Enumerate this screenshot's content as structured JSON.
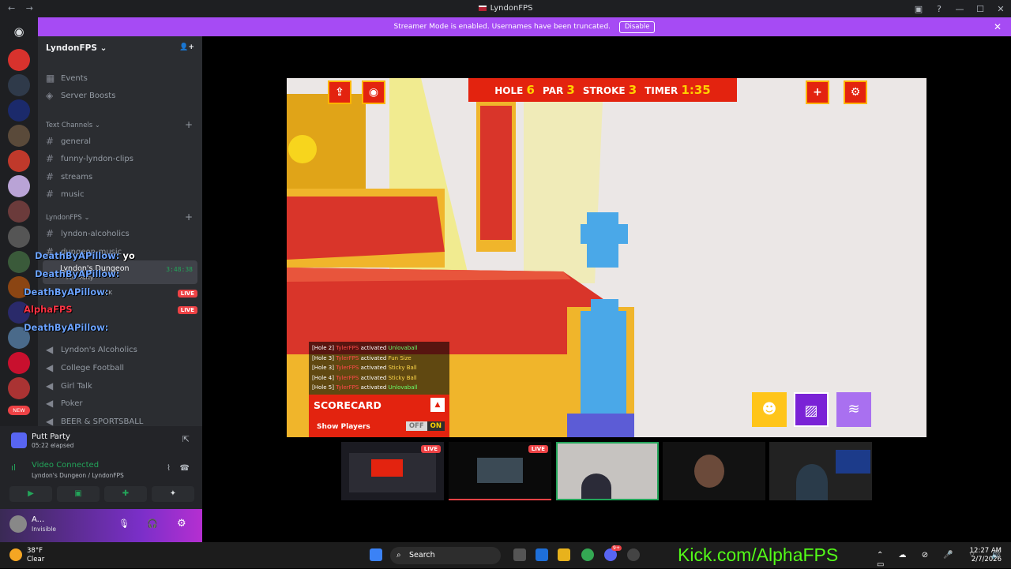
{
  "window": {
    "title": "LyndonFPS",
    "nav_back": "←",
    "nav_fwd": "→",
    "btn_inbox": "▣",
    "btn_help": "?",
    "btn_min": "—",
    "btn_max": "☐",
    "btn_close": "✕"
  },
  "banner": {
    "text": "Streamer Mode is enabled. Usernames have been truncated.",
    "disable_label": "Disable",
    "close_label": "✕"
  },
  "guild": {
    "name": "LyndonFPS",
    "chevron": "⌄",
    "invite_icon": "👤+"
  },
  "channels": {
    "top_items": [
      {
        "label": "Events"
      },
      {
        "label": "Server Boosts"
      }
    ],
    "cat_text": "Text Channels",
    "cat_lyndon": "LyndonFPS",
    "cat_plus": "+",
    "cat_chevron": "⌄",
    "text": [
      {
        "label": "general"
      },
      {
        "label": "funny-lyndon-clips"
      },
      {
        "label": "streams"
      },
      {
        "label": "music"
      }
    ],
    "lyndon": [
      {
        "label": "lyndon-alcoholics"
      },
      {
        "label": "dungeon-music"
      }
    ],
    "voice": {
      "label": "Lyndon's Dungeon",
      "timer": "3:48:38",
      "activity": "Putt Party",
      "member_kick": "KICK"
    },
    "live_badge": "LIVE",
    "more": [
      {
        "label": "Lyndon's Alcoholics"
      },
      {
        "label": "College Football"
      },
      {
        "label": "Girl Talk"
      },
      {
        "label": "Poker"
      },
      {
        "label": "BEER & SPORTSBALL"
      }
    ]
  },
  "chat_overlay": [
    {
      "user": "DeathByAPillow:",
      "msg": "yo"
    },
    {
      "user": "DeathByAPillow:",
      "msg": ""
    },
    {
      "user": "DeathByAPillow:",
      "msg": ""
    },
    {
      "user": "AlphaFPS",
      "msg": ""
    },
    {
      "user": "DeathByAPillow:",
      "msg": ""
    }
  ],
  "activity_panel": {
    "title": "Putt Party",
    "elapsed": "05:22 elapsed"
  },
  "voice_panel": {
    "status": "Video Connected",
    "sub": "Lyndon's Dungeon / LyndonFPS"
  },
  "user": {
    "name": "A...",
    "status": "Invisible"
  },
  "game": {
    "hole_label": "HOLE",
    "hole": "6",
    "par_label": "PAR",
    "par": "3",
    "stroke_label": "STROKE",
    "stroke": "3",
    "timer_label": "TIMER",
    "timer": "1:35",
    "feed": [
      {
        "hole": "[Hole 2]",
        "player": "TylerFPS",
        "verb": "activated",
        "power": "Unlovaball"
      },
      {
        "hole": "[Hole 3]",
        "player": "TylerFPS",
        "verb": "activated",
        "power": "Fun Size"
      },
      {
        "hole": "[Hole 3]",
        "player": "TylerFPS",
        "verb": "activated",
        "power": "Sticky Ball"
      },
      {
        "hole": "[Hole 4]",
        "player": "TylerFPS",
        "verb": "activated",
        "power": "Sticky Ball"
      },
      {
        "hole": "[Hole 5]",
        "player": "TylerFPS",
        "verb": "activated",
        "power": "Unlovaball"
      }
    ],
    "scorecard": "SCORECARD",
    "show_players": "Show Players",
    "toggle_off": "OFF",
    "toggle_on": "ON"
  },
  "cams": [
    {
      "live": "LIVE"
    },
    {
      "live": "LIVE"
    }
  ],
  "taskbar": {
    "temp": "38°F",
    "weather": "Clear",
    "search": "Search",
    "time": "12:27 AM",
    "date": "2/7/2026",
    "badge": "9+"
  },
  "overlay_kick": "Kick.com/AlphaFPS",
  "colors": {
    "brand_purple": "#a64bf4",
    "game_red": "#e3230f",
    "kick_green": "#53fc18",
    "live_red": "#ed4245"
  }
}
